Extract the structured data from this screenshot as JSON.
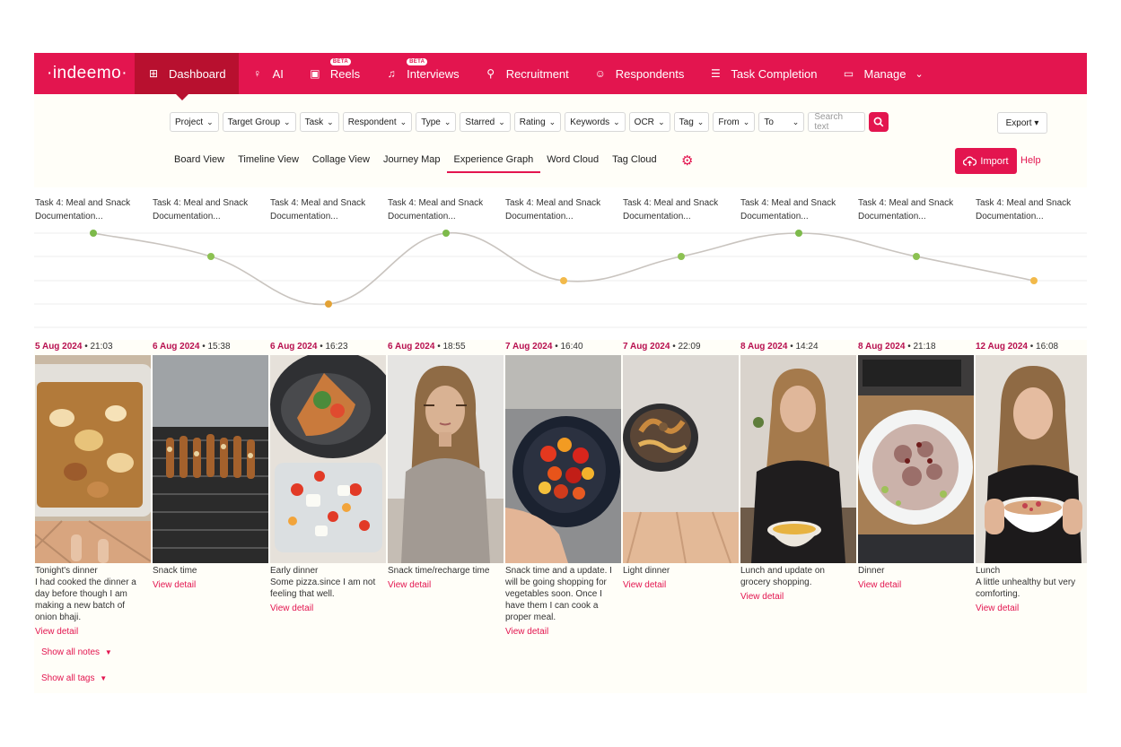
{
  "brand": {
    "logo": "·indeemo·",
    "accent": "#e3154f",
    "accent_dark": "#b8102f"
  },
  "nav": {
    "items": [
      {
        "label": "Dashboard",
        "icon": "grid-icon",
        "active": true
      },
      {
        "label": "AI",
        "icon": "lightbulb-icon"
      },
      {
        "label": "Reels",
        "icon": "document-icon",
        "badge": "BETA"
      },
      {
        "label": "Interviews",
        "icon": "microphone-icon",
        "badge": "BETA"
      },
      {
        "label": "Recruitment",
        "icon": "user-search-icon"
      },
      {
        "label": "Respondents",
        "icon": "users-icon"
      },
      {
        "label": "Task Completion",
        "icon": "checklist-icon"
      },
      {
        "label": "Manage",
        "icon": "briefcase-icon"
      }
    ],
    "more_icon": "chevron-down-icon"
  },
  "filters": [
    "Project",
    "Target Group",
    "Task",
    "Respondent",
    "Type",
    "Starred",
    "Rating",
    "Keywords",
    "OCR",
    "Tag",
    "From",
    "To"
  ],
  "search": {
    "placeholder": "Search text"
  },
  "export_label": "Export ▾",
  "views": [
    "Board View",
    "Timeline View",
    "Collage View",
    "Journey Map",
    "Experience Graph",
    "Word Cloud",
    "Tag Cloud"
  ],
  "active_view": "Experience Graph",
  "import_label": "Import",
  "help_label": "Help",
  "graph": {
    "levels": 4,
    "points": [
      {
        "label": "Task 4: Meal and Snack Documentation...",
        "level": 4,
        "color": "#7dba4b"
      },
      {
        "label": "Task 4: Meal and Snack Documentation...",
        "level": 3,
        "color": "#8cc152"
      },
      {
        "label": "Task 4: Meal and Snack Documentation...",
        "level": 1,
        "color": "#e3a235"
      },
      {
        "label": "Task 4: Meal and Snack Documentation...",
        "level": 4,
        "color": "#7dba4b"
      },
      {
        "label": "Task 4: Meal and Snack Documentation...",
        "level": 2,
        "color": "#f2b94a"
      },
      {
        "label": "Task 4: Meal and Snack Documentation...",
        "level": 3,
        "color": "#8cc152"
      },
      {
        "label": "Task 4: Meal and Snack Documentation...",
        "level": 4,
        "color": "#7dba4b"
      },
      {
        "label": "Task 4: Meal and Snack Documentation...",
        "level": 3,
        "color": "#8cc152"
      },
      {
        "label": "Task 4: Meal and Snack Documentation...",
        "level": 2,
        "color": "#f2b94a"
      }
    ]
  },
  "entries": [
    {
      "date": "5 Aug 2024",
      "time": "• 21:03",
      "caption": "Tonight's dinner\nI had cooked the dinner a day before though I am making a new batch of onion bhaji.",
      "link": "View detail",
      "photo": "roast-tray"
    },
    {
      "date": "6 Aug 2024",
      "time": "• 15:38",
      "caption": "Snack time",
      "link": "View detail",
      "photo": "kebab-grill"
    },
    {
      "date": "6 Aug 2024",
      "time": "• 16:23",
      "caption": "Early dinner\nSome pizza.since I am not feeling that well.",
      "link": "View detail",
      "photo": "pizza-salad"
    },
    {
      "date": "6 Aug 2024",
      "time": "• 18:55",
      "caption": "Snack time/recharge time",
      "link": "View detail",
      "photo": "woman-selfie"
    },
    {
      "date": "7 Aug 2024",
      "time": "• 16:40",
      "caption": "Snack time and a update. I will be going shopping for vegetables soon. Once I have them I can cook a proper meal.",
      "link": "View detail",
      "photo": "tomato-bowl"
    },
    {
      "date": "7 Aug 2024",
      "time": "• 22:09",
      "caption": "Light dinner",
      "link": "View detail",
      "photo": "noodle-bowl"
    },
    {
      "date": "8 Aug 2024",
      "time": "• 14:24",
      "caption": "Lunch and update on grocery shopping.",
      "link": "View detail",
      "photo": "woman-soup"
    },
    {
      "date": "8 Aug 2024",
      "time": "• 21:18",
      "caption": "Dinner",
      "link": "View detail",
      "photo": "tuna-bowl"
    },
    {
      "date": "12 Aug 2024",
      "time": "• 16:08",
      "caption": "Lunch\nA little unhealthy but very comforting.",
      "link": "View detail",
      "photo": "woman-bowl"
    }
  ],
  "show_notes": "Show all notes",
  "show_tags": "Show all tags"
}
